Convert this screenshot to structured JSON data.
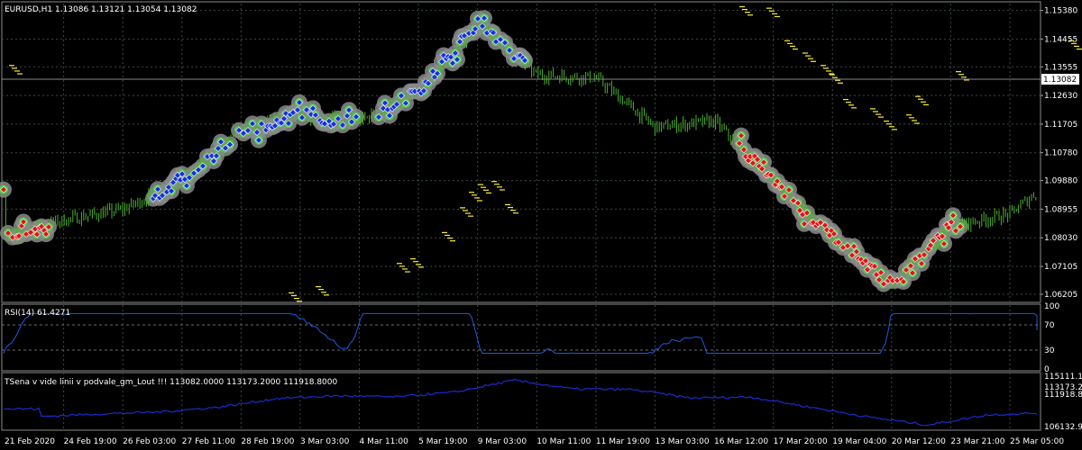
{
  "header": {
    "symbol_line": "EURUSD,H1  1.13086 1.13121 1.13054 1.13082"
  },
  "current_price_label": "1.13082",
  "price_axis": [
    "1.15380",
    "1.14455",
    "1.13555",
    "1.12630",
    "1.11705",
    "1.10780",
    "1.09880",
    "1.08955",
    "1.08030",
    "1.07105",
    "1.06205"
  ],
  "rsi": {
    "label": "RSI(14) 61.4271",
    "levels": [
      "100",
      "70",
      "30",
      "0"
    ]
  },
  "custom_indicator": {
    "label": "TSena v vide linii v podvale_gm_Lout !!! 113082.0000 113173.2000 111918.8000",
    "levels": [
      "115111.1",
      "113173.2",
      "111918.8",
      "106132.9"
    ]
  },
  "time_axis": [
    "21 Feb 2020",
    "24 Feb 19:00",
    "26 Feb 03:00",
    "27 Feb 11:00",
    "28 Feb 19:00",
    "3 Mar 03:00",
    "4 Mar 11:00",
    "5 Mar 19:00",
    "9 Mar 03:00",
    "10 Mar 11:00",
    "11 Mar 19:00",
    "13 Mar 03:00",
    "16 Mar 12:00",
    "17 Mar 20:00",
    "19 Mar 04:00",
    "20 Mar 12:00",
    "23 Mar 21:00",
    "25 Mar 05:00"
  ],
  "colors": {
    "background": "#000000",
    "grid": "#3a4a3a",
    "candles": "#4caf30",
    "rsi_line": "#1e5adc",
    "custom_line": "#1a2ccc",
    "buy_marker": "#1530e0",
    "sell_marker": "#e01515",
    "yellow_marks": "#ffee30"
  },
  "chart_data": {
    "type": "candlestick",
    "symbol": "EURUSD",
    "timeframe": "H1",
    "ohlc_last": {
      "open": 1.13086,
      "high": 1.13121,
      "low": 1.13054,
      "close": 1.13082
    },
    "ylim": [
      1.06,
      1.156
    ],
    "path": [
      {
        "t": "21 Feb 2020",
        "p": 1.081
      },
      {
        "t": "24 Feb 19:00",
        "p": 1.086
      },
      {
        "t": "26 Feb 03:00",
        "p": 1.0895
      },
      {
        "t": "27 Feb 11:00",
        "p": 1.0985
      },
      {
        "t": "28 Feb 19:00",
        "p": 1.115
      },
      {
        "t": "3 Mar 03:00",
        "p": 1.12
      },
      {
        "t": "4 Mar 11:00",
        "p": 1.118
      },
      {
        "t": "5 Mar 19:00",
        "p": 1.127
      },
      {
        "t": "9 Mar 03:00",
        "p": 1.1495
      },
      {
        "t": "10 Mar 11:00",
        "p": 1.133
      },
      {
        "t": "11 Mar 19:00",
        "p": 1.132
      },
      {
        "t": "13 Mar 03:00",
        "p": 1.116
      },
      {
        "t": "16 Mar 12:00",
        "p": 1.118
      },
      {
        "t": "17 Mar 20:00",
        "p": 1.099
      },
      {
        "t": "19 Mar 04:00",
        "p": 1.08
      },
      {
        "t": "20 Mar 12:00",
        "p": 1.065
      },
      {
        "t": "23 Mar 21:00",
        "p": 1.084
      },
      {
        "t": "25 Mar 05:00",
        "p": 1.088
      }
    ],
    "rsi_range": [
      0,
      100
    ],
    "rsi_last": 61.4271,
    "custom_range": [
      106132.9,
      115111.1
    ],
    "custom_last": 113082.0
  }
}
